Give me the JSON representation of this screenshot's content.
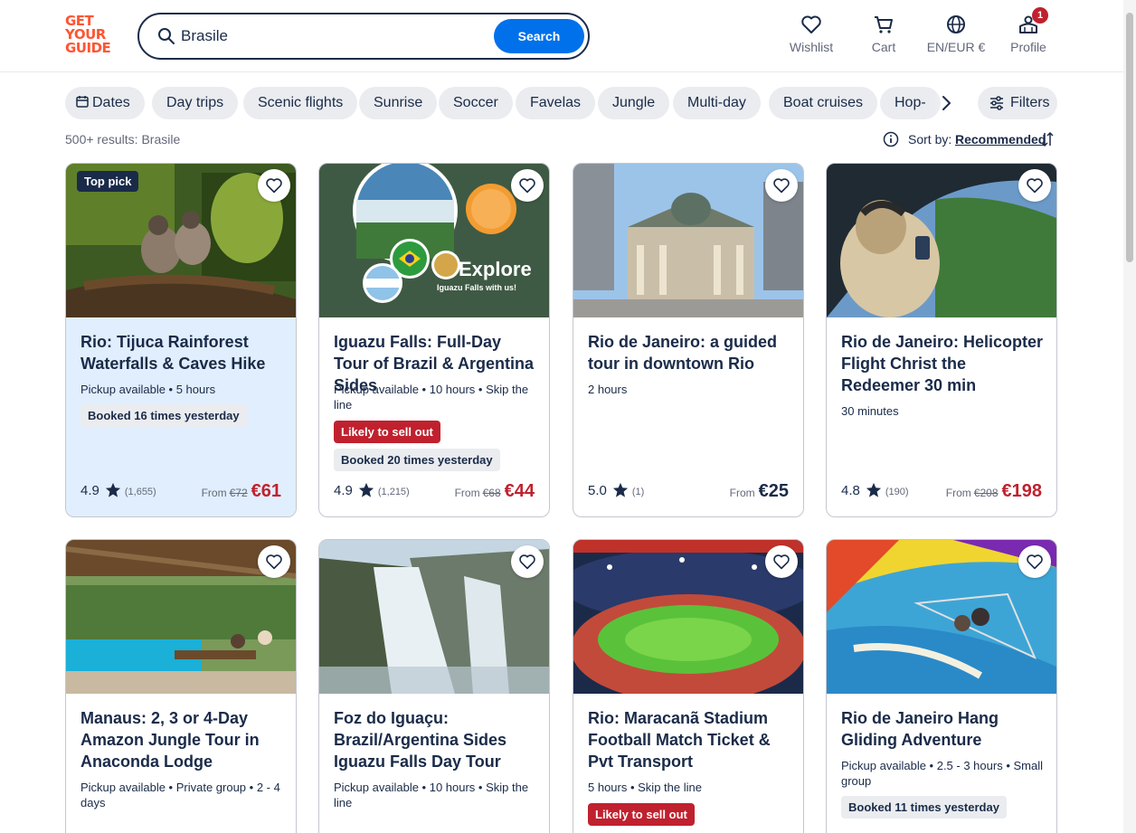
{
  "header": {
    "logo_lines": [
      "GET",
      "YOUR",
      "GUIDE"
    ],
    "search_value": "Brasile",
    "search_button": "Search",
    "nav": {
      "wishlist": "Wishlist",
      "cart": "Cart",
      "language": "EN/EUR €",
      "profile": "Profile",
      "profile_badge": "1"
    }
  },
  "chips": [
    "Dates",
    "Day trips",
    "Scenic flights",
    "Sunrise",
    "Soccer",
    "Favelas",
    "Jungle",
    "Multi-day",
    "Boat cruises",
    "Hop-"
  ],
  "filters_label": "Filters",
  "results_text": "500+ results: Brasile",
  "sort": {
    "label": "Sort by:",
    "value": "Recommended"
  },
  "cards": [
    {
      "badge": "Top pick",
      "title": "Rio: Tijuca Rainforest Waterfalls & Caves Hike",
      "meta": "Pickup available • 5 hours",
      "booked": "Booked 16 times yesterday",
      "rating": "4.9",
      "reviews": "(1,655)",
      "from": "From",
      "old_price": "€72",
      "price": "€61",
      "image": "marmoset-monkeys-on-branch"
    },
    {
      "title": "Iguazu Falls: Full-Day Tour of Brazil & Argentina Sides",
      "meta": "Pickup available • 10 hours • Skip the line",
      "sellout": "Likely to sell out",
      "booked": "Booked 20 times yesterday",
      "rating": "4.9",
      "reviews": "(1,215)",
      "from": "From",
      "old_price": "€68",
      "price": "€44",
      "image": "iguazu-falls-promo-collage",
      "promo_text": "Explore",
      "promo_sub": "Iguazu Falls with us!"
    },
    {
      "title": "Rio de Janeiro: a guided tour in downtown Rio",
      "meta": "2 hours",
      "rating": "5.0",
      "reviews": "(1)",
      "from": "From",
      "price": "€25",
      "image": "municipal-theatre-building"
    },
    {
      "title": "Rio de Janeiro: Helicopter Flight Christ the Redeemer 30 min",
      "meta": "30 minutes",
      "rating": "4.8",
      "reviews": "(190)",
      "from": "From",
      "old_price": "€208",
      "price": "€198",
      "image": "helicopter-passenger-view"
    },
    {
      "title": "Manaus: 2, 3 or 4-Day Amazon Jungle Tour in Anaconda Lodge",
      "meta": "Pickup available • Private group • 2 - 4 days",
      "image": "jungle-lodge-pool"
    },
    {
      "title": "Foz do Iguaçu: Brazil/Argentina Sides Iguazu Falls Day Tour",
      "meta": "Pickup available • 10 hours • Skip the line",
      "image": "iguazu-waterfall"
    },
    {
      "title": "Rio: Maracanã Stadium Football Match Ticket & Pvt Transport",
      "meta": "5 hours • Skip the line",
      "sellout": "Likely to sell out",
      "image": "maracana-stadium"
    },
    {
      "title": "Rio de Janeiro Hang Gliding Adventure",
      "meta": "Pickup available • 2.5 - 3 hours • Small group",
      "booked": "Booked 11 times yesterday",
      "image": "hang-glider-over-beach"
    }
  ],
  "colors": {
    "brand": "#ff5533",
    "primary": "#0071eb",
    "text": "#1a2b49",
    "deal": "#c0212e",
    "highlight_bg": "#e1eefd"
  }
}
